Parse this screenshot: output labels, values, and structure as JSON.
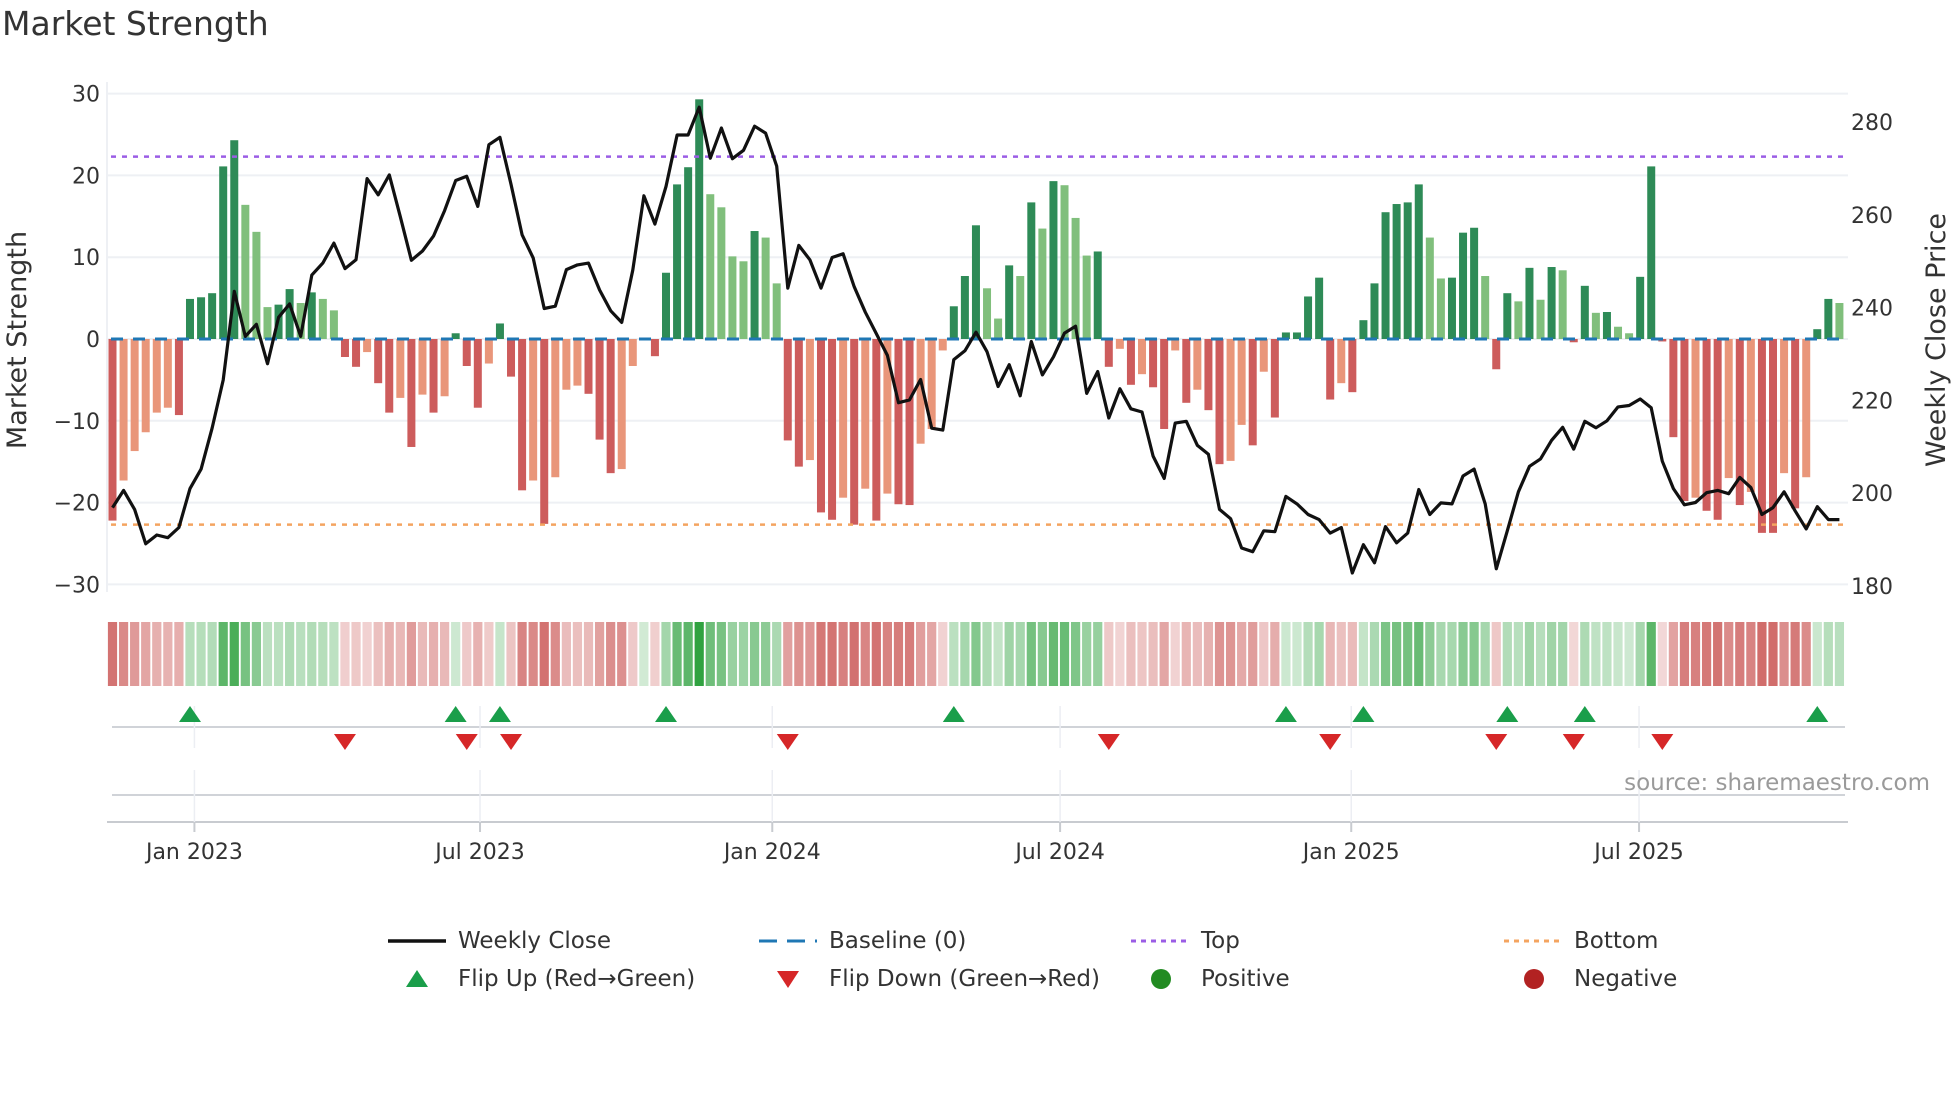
{
  "title": "Market Strength",
  "source": "source: sharemaestro.com",
  "colors": {
    "pos_strong": "#2e8b57",
    "pos_weak": "#80bf7c",
    "neg_strong": "#cd5c5c",
    "neg_weak": "#e9967a",
    "line": "#111111",
    "baseline": "#1f77b4",
    "top": "#9b5de5",
    "bottom": "#f4a460",
    "flip_up": "#1a9e4a",
    "flip_down": "#d62728",
    "positive": "#228b22",
    "negative": "#b22222"
  },
  "legend": [
    {
      "label": "Weekly Close",
      "icon": "solid-line"
    },
    {
      "label": "Baseline (0)",
      "icon": "dashed-line"
    },
    {
      "label": "Top",
      "icon": "dotted-line-purple"
    },
    {
      "label": "Bottom",
      "icon": "dotted-line-orange"
    },
    {
      "label": "Flip Up (Red→Green)",
      "icon": "triangle-up"
    },
    {
      "label": "Flip Down (Green→Red)",
      "icon": "triangle-down"
    },
    {
      "label": "Positive",
      "icon": "circle-green"
    },
    {
      "label": "Negative",
      "icon": "circle-red"
    }
  ],
  "chart_data": {
    "type": "bar+line",
    "title": "Market Strength",
    "ylabel": "Market Strength",
    "y2label": "Weekly Close Price",
    "ylim": [
      -30,
      30
    ],
    "y2lim": [
      180,
      280
    ],
    "yticks": [
      30,
      20,
      10,
      0,
      -10,
      -20,
      -30
    ],
    "yticklabels": [
      "30",
      "20",
      "10",
      "0",
      "−10",
      "−20",
      "−30"
    ],
    "y2ticks": [
      280,
      260,
      240,
      220,
      200,
      180
    ],
    "y2ticklabels": [
      "280",
      "260",
      "240",
      "220",
      "200",
      "180"
    ],
    "top_level": 22.3,
    "bottom_level": -22.7,
    "baseline": 0,
    "xticks": [
      {
        "label": "Jan 2023",
        "week": 7.4
      },
      {
        "label": "Jul 2023",
        "week": 33.2
      },
      {
        "label": "Jan 2024",
        "week": 59.6
      },
      {
        "label": "Jul 2024",
        "week": 85.6
      },
      {
        "label": "Jan 2025",
        "week": 111.9
      },
      {
        "label": "Jul 2025",
        "week": 137.9
      }
    ],
    "strength": [
      -22.2,
      -17.3,
      -13.7,
      -11.4,
      -9.0,
      -8.4,
      -9.3,
      4.9,
      5.1,
      5.6,
      21.1,
      24.3,
      16.4,
      13.1,
      3.9,
      4.2,
      6.1,
      4.4,
      5.7,
      4.9,
      3.5,
      -2.2,
      -3.4,
      -1.6,
      -5.4,
      -9.0,
      -7.2,
      -13.2,
      -6.8,
      -9.0,
      -7.0,
      0.7,
      -3.3,
      -8.4,
      -3.0,
      1.9,
      -4.6,
      -18.5,
      -17.3,
      -22.6,
      -16.9,
      -6.2,
      -5.7,
      -6.7,
      -12.3,
      -16.4,
      -15.9,
      -3.3,
      0,
      -2.1,
      8.1,
      18.9,
      21.0,
      29.3,
      17.7,
      16.1,
      10.1,
      9.5,
      13.2,
      12.4,
      6.8,
      -12.4,
      -15.6,
      -14.8,
      -21.2,
      -22.1,
      -19.4,
      -22.7,
      -18.3,
      -22.2,
      -18.9,
      -20.2,
      -20.3,
      -12.8,
      -11.0,
      -1.4,
      4.0,
      7.7,
      13.9,
      6.2,
      2.5,
      9.0,
      7.7,
      16.7,
      13.5,
      19.3,
      18.8,
      14.8,
      10.2,
      10.7,
      -3.4,
      -1.2,
      -5.6,
      -4.3,
      -5.9,
      -11.0,
      -1.4,
      -7.8,
      -6.2,
      -8.7,
      -15.3,
      -14.9,
      -10.5,
      -13.0,
      -4.0,
      -9.6,
      0.8,
      0.8,
      5.2,
      7.5,
      -7.4,
      -5.4,
      -6.5,
      2.3,
      6.8,
      15.5,
      16.5,
      16.7,
      18.9,
      12.4,
      7.4,
      7.5,
      13.0,
      13.6,
      7.7,
      -3.7,
      5.6,
      4.6,
      8.7,
      4.8,
      8.8,
      8.4,
      -0.4,
      6.5,
      3.2,
      3.3,
      1.5,
      0.7,
      7.6,
      21.1,
      -0.3,
      -12.0,
      -19.8,
      -19.4,
      -21.0,
      -22.1,
      -17.0,
      -20.3,
      -18.7,
      -23.7,
      -23.7,
      -16.4,
      -20.7,
      -16.9,
      1.2,
      4.9,
      4.4
    ],
    "weekly_close": [
      196.9,
      200.6,
      196.5,
      189.1,
      191.0,
      190.4,
      192.6,
      201.0,
      205.2,
      214.0,
      224.4,
      243.5,
      233.8,
      236.4,
      227.9,
      237.9,
      240.8,
      233.8,
      247.0,
      249.6,
      253.9,
      248.4,
      250.3,
      267.8,
      264.3,
      268.6,
      259.6,
      250.2,
      252.2,
      255.4,
      260.9,
      267.4,
      268.3,
      261.8,
      275.1,
      276.7,
      266.6,
      255.7,
      250.7,
      239.8,
      240.3,
      248.2,
      249.2,
      249.6,
      243.8,
      239.3,
      236.8,
      248.1,
      264.1,
      258.0,
      266.1,
      277.2,
      277.2,
      283.2,
      272.2,
      278.7,
      272.1,
      273.9,
      279.1,
      277.6,
      270.5,
      244.2,
      253.4,
      250.3,
      244.2,
      250.8,
      251.6,
      244.5,
      239.0,
      234.4,
      229.7,
      219.5,
      220.1,
      224.5,
      214.0,
      213.6,
      228.8,
      230.7,
      234.7,
      230.5,
      223.0,
      227.7,
      221.0,
      232.7,
      225.5,
      229.4,
      234.5,
      236.0,
      221.5,
      226.2,
      216.2,
      222.5,
      218.2,
      217.5,
      208.0,
      203.2,
      215.1,
      215.5,
      210.3,
      208.4,
      196.5,
      194.5,
      188.2,
      187.4,
      191.9,
      191.7,
      199.3,
      197.7,
      195.4,
      194.3,
      191.4,
      192.6,
      182.8,
      188.9,
      185.0,
      192.8,
      189.3,
      191.4,
      200.8,
      195.4,
      197.9,
      197.7,
      203.7,
      205.2,
      197.7,
      183.7,
      191.9,
      200.3,
      205.8,
      207.4,
      211.4,
      214.2,
      209.5,
      215.5,
      214.1,
      215.6,
      218.6,
      218.9,
      220.3,
      218.4,
      206.9,
      201.0,
      197.5,
      198.0,
      200.1,
      200.6,
      199.9,
      203.4,
      201.2,
      195.4,
      196.9,
      200.3,
      196.2,
      192.3,
      197.1,
      194.3,
      194.3
    ]
  }
}
